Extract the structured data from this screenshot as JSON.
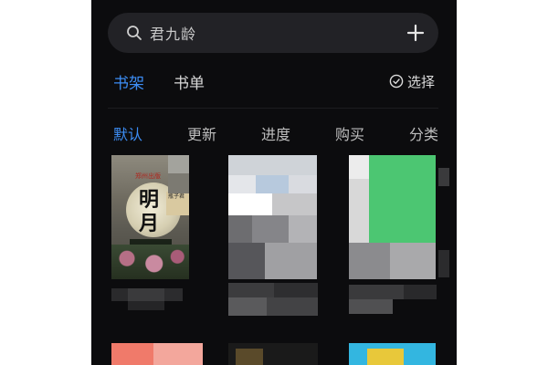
{
  "search": {
    "text": "君九龄"
  },
  "top_tabs": [
    {
      "label": "书架",
      "active": true
    },
    {
      "label": "书单",
      "active": false
    }
  ],
  "select_label": "选择",
  "sort_tabs": [
    {
      "label": "默认",
      "active": true
    },
    {
      "label": "更新",
      "active": false
    },
    {
      "label": "进度",
      "active": false
    },
    {
      "label": "购买",
      "active": false
    },
    {
      "label": "分类",
      "active": false
    }
  ],
  "book1_cover": {
    "title": "明月",
    "publisher": "郑州出版",
    "author": "瓶子君"
  },
  "colors": {
    "accent": "#3d8ef5",
    "background": "#0c0c0e",
    "search_bg": "#222226"
  },
  "icons": [
    "search-icon",
    "add-icon",
    "check-circle-icon"
  ]
}
